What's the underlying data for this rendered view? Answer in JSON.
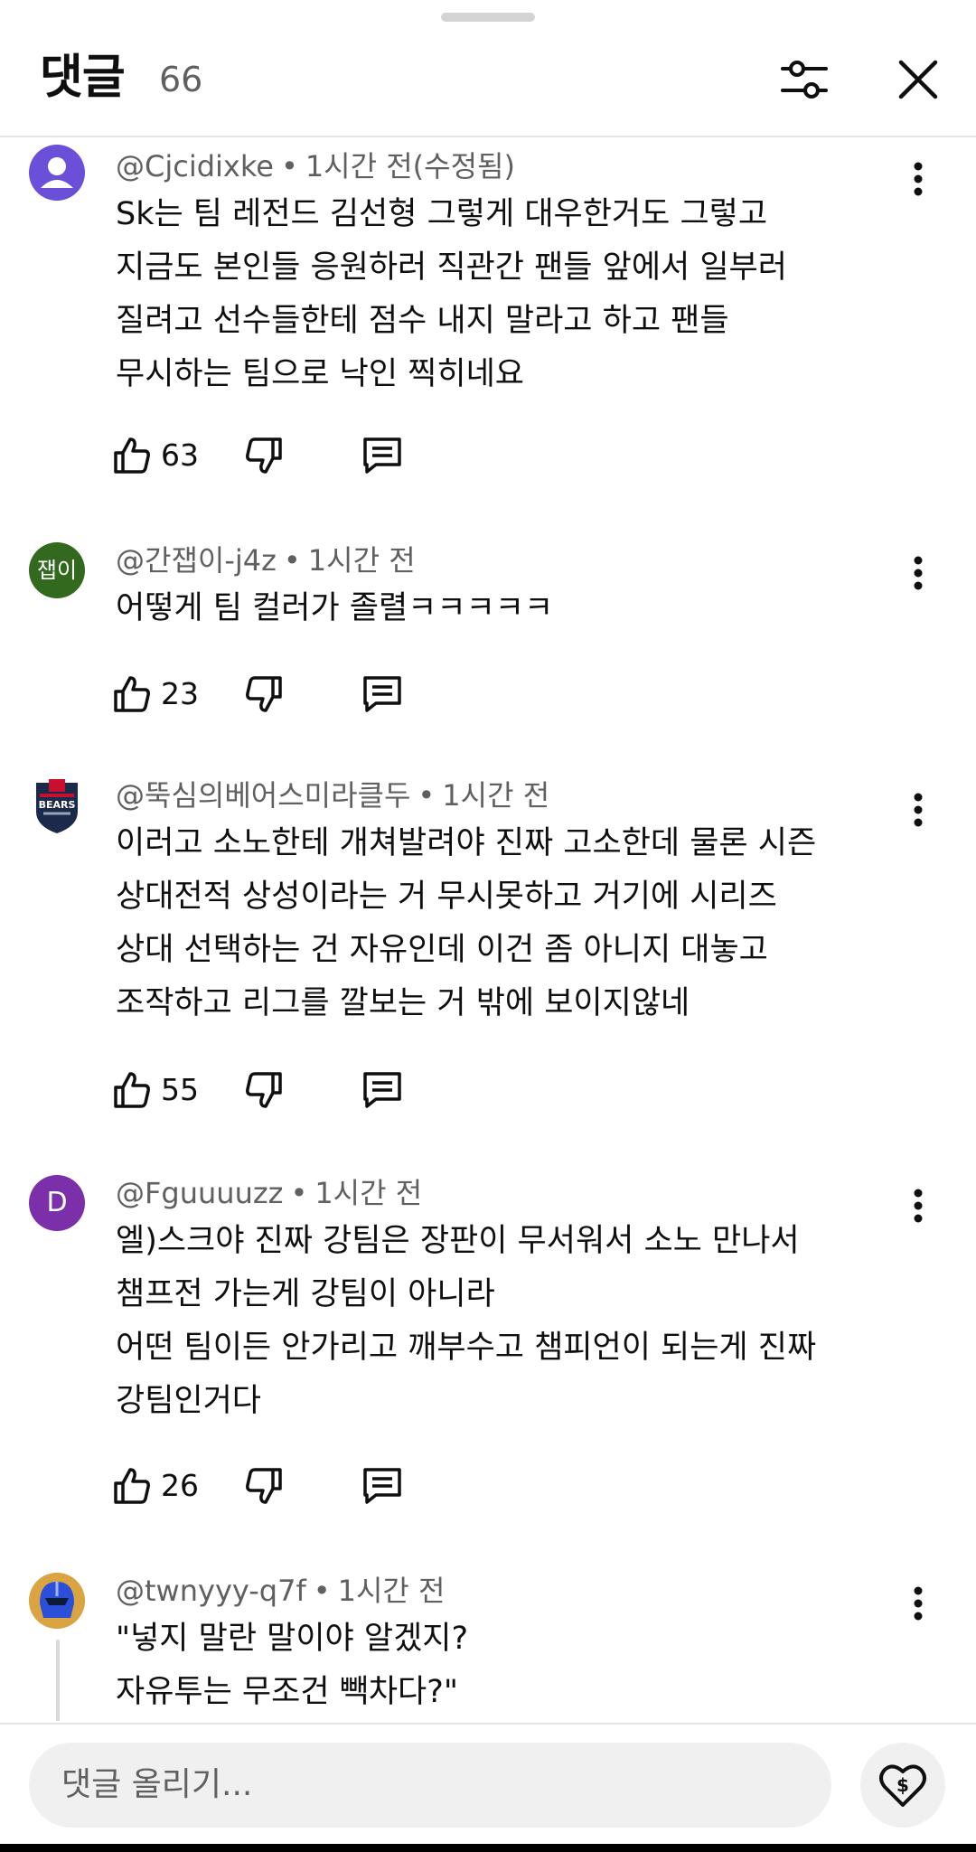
{
  "header": {
    "title": "댓글",
    "count": "66",
    "filter_icon": "sliders-icon",
    "close_icon": "close-icon"
  },
  "colors": {
    "text_primary": "#0f0f0f",
    "text_secondary": "#606060",
    "divider": "#e5e5e5"
  },
  "comments": [
    {
      "author": "@Cjcidixke",
      "time": "1시간 전(수정됨)",
      "avatar": {
        "type": "default-user",
        "color": "#6b4fd8"
      },
      "text": "Sk는 팀 레전드 김선형 그렇게 대우한거도 그렇고\n지금도 본인들 응원하러 직관간 팬들 앞에서 일부러\n질려고 선수들한테 점수 내지 말라고 하고 팬들\n무시하는 팀으로 낙인 찍히네요",
      "likes": "63"
    },
    {
      "author": "@간잽이-j4z",
      "time": "1시간 전",
      "avatar": {
        "type": "text",
        "label": "잽이",
        "color": "#33691e"
      },
      "text": "어떻게 팀 컬러가 졸렬ㅋㅋㅋㅋㅋ",
      "likes": "23"
    },
    {
      "author": "@뚝심의베어스미라클두",
      "time": "1시간 전",
      "avatar": {
        "type": "logo",
        "label": "BEARS",
        "color": "#1b2a4a"
      },
      "text": "이러고 소노한테 개쳐발려야 진짜 고소한데  물론 시즌\n상대전적 상성이라는 거 무시못하고 거기에 시리즈\n상대 선택하는 건 자유인데 이건 좀 아니지 대놓고\n조작하고 리그를 깔보는 거 밖에 보이지않네",
      "likes": "55"
    },
    {
      "author": "@Fguuuuzz",
      "time": "1시간 전",
      "avatar": {
        "type": "letter",
        "label": "D",
        "color": "#7b2fa8"
      },
      "text": "엘)스크야 진짜 강팀은 장판이 무서워서 소노 만나서\n챔프전 가는게 강팀이 아니라\n어떤 팀이든 안가리고 깨부수고 챔피언이 되는게 진짜\n강팀인거다",
      "likes": "26"
    },
    {
      "author": "@twnyyy-q7f",
      "time": "1시간 전",
      "avatar": {
        "type": "helmet",
        "color": "#2b4fd8"
      },
      "text": "\"넣지 말란 말이야 알겠지?\n자유투는 무조건 빽차다?\""
    }
  ],
  "composer": {
    "placeholder": "댓글 올리기...",
    "thanks_icon": "super-thanks-heart-icon"
  }
}
